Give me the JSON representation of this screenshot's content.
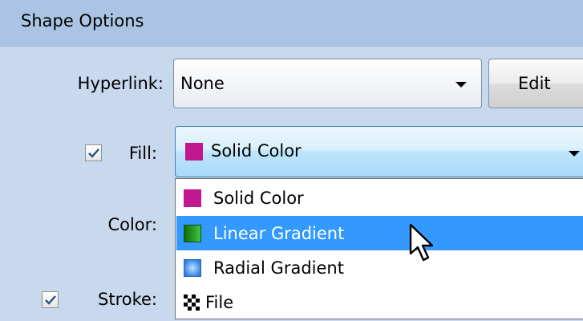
{
  "panel": {
    "title": "Shape Options"
  },
  "hyperlink": {
    "label": "Hyperlink:",
    "value": "None",
    "edit_label": "Edit"
  },
  "fill": {
    "label": "Fill:",
    "checked": true,
    "value": "Solid Color",
    "swatch_color": "#c0168e"
  },
  "color": {
    "label": "Color:"
  },
  "stroke": {
    "label": "Stroke:",
    "checked": true
  },
  "dropdown": {
    "items": [
      {
        "label": "Solid Color",
        "icon": "solid-color-swatch",
        "color": "#c0168e",
        "selected": false
      },
      {
        "label": "Linear Gradient",
        "icon": "linear-gradient-swatch",
        "color": "#1b9d1b",
        "selected": true
      },
      {
        "label": "Radial Gradient",
        "icon": "radial-gradient-swatch",
        "color": "#2f7fe0",
        "selected": false
      },
      {
        "label": "File",
        "icon": "checker-file-icon",
        "selected": false
      }
    ]
  },
  "colors": {
    "panel_background": "#c8d9ee",
    "header_background": "#abc4e3",
    "selection": "#3399ff"
  }
}
